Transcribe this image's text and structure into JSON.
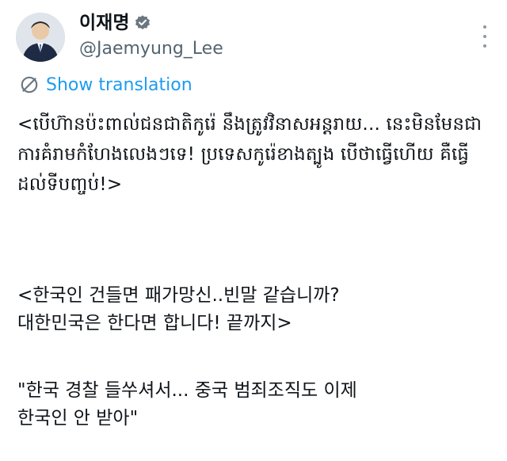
{
  "author": {
    "display_name": "이재명",
    "handle": "@Jaemyung_Lee",
    "verified_icon": "verified-badge-icon",
    "avatar_icon": "profile-avatar"
  },
  "translate": {
    "label": "Show translation",
    "icon": "globe-icon"
  },
  "tweet": {
    "para1": "<បើហ៊ានប៉ះពាល់ជនជាតិកូរ៉េ នឹងត្រូវវិនាសអន្តរាយ... នេះមិនមែនជាការគំរាមកំហែងលេងៗទេ! ប្រទេសកូរ៉េខាងត្បូង បើថាធ្វើហើយ គឺធ្វើដល់ទីបញ្ចប់!>",
    "para2": "<한국인 건들면 패가망신..빈말 같습니까?\n대한민국은 한다면 합니다! 끝까지>",
    "para3": "\"한국 경찰 들쑤셔서... 중국 범죄조직도 이제\n한국인 안 받아\""
  },
  "colors": {
    "accent": "#1d9bf0",
    "secondary_text": "#536471",
    "primary_text": "#0f1419"
  }
}
